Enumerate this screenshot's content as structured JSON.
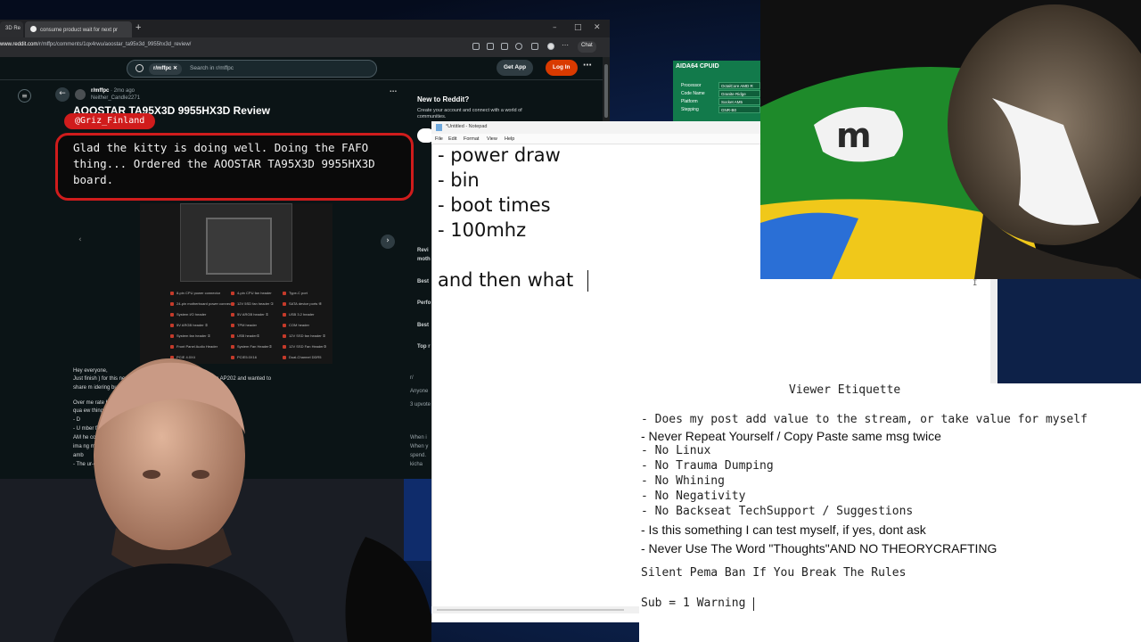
{
  "browser": {
    "tabs": [
      {
        "label": "3D Re"
      },
      {
        "label": "consume product wait for next pr"
      }
    ],
    "url_prefix": "www.reddit.com",
    "url_path": "/r/mffpc/comments/1qx4rwu/aoostar_ta95x3d_9955hx3d_review/",
    "chat_label": "Chat"
  },
  "reddit": {
    "search_chip": "r/mffpc",
    "search_placeholder": "Search in r/mffpc",
    "get_app": "Get App",
    "login": "Log In",
    "subreddit": "r/mffpc",
    "post_age": "· 2mo ago",
    "author": "Neither_Candle2271",
    "post_title": "AOOSTAR TA95X3D 9955HX3D Review",
    "image_legend": [
      "8-pin CPU power connector",
      "4-pin CPU fan header",
      "Type-C port",
      "24-pin motherboard power connector",
      "12V 5SD fan header ①",
      "SATA device ports ④",
      "System I/O header",
      "5V ARGB header ①",
      "USB 3.2 header",
      "5V ARGB header ②",
      "TPM header",
      "COM header",
      "System fan header ①",
      "USB header①",
      "12V SSD fan header ②",
      "Front Panel Audio Header",
      "System Fan Header②",
      "12V SSD Fan Header③",
      "PCIE 4.0X4",
      "PCIE5.0X16",
      "Dual-Channel DDR5"
    ],
    "body_lines": [
      "Hey everyone,",
      "Just finish                              ) for this newer Aoostar TA95X3D in my son's Asus AP202 and wanted to",
      "share m                                    idering buying this board.",
      "Over                                        me rate by about 20%. I am extremely impressed with the build",
      "qua                                          ew things:",
      "- D",
      "- U                                         mber fitted on the board sits a little higher than a standard",
      "AM                                          he cooler's fixing plate a little to fit the Deepcool 4S. I would",
      "ima                                         ng max temps around 65 °C with this cooler in 28 °C",
      "amb",
      "- The                                       ur-controlled by the BIOS only. So opted to use a Nollie USB"
    ],
    "rail": {
      "new_title": "New to Reddit?",
      "new_desc": "Create your account and connect with a world of communities.",
      "items": [
        "Revi",
        "moth",
        "Best",
        "Perfo",
        "Best",
        "Top r"
      ],
      "comment_lines": [
        "r/",
        "Anyone",
        "3 upvote",
        "When i",
        "When y",
        "spend.",
        "kicha"
      ]
    }
  },
  "chat_overlay": {
    "user": "@Griz_Finland",
    "message": "Glad the kitty is doing well. Doing the FAFO thing... Ordered the AOOSTAR TA95X3D 9955HX3D board."
  },
  "aida": {
    "title": "AIDA64 CPUID",
    "rows": [
      {
        "key": "Processor",
        "value": "OctalCore AMD R"
      },
      {
        "key": "Code Name",
        "value": "Granite Ridge"
      },
      {
        "key": "Platform",
        "value": "Socket AM5"
      },
      {
        "key": "Stepping",
        "value": "GNR-B0"
      }
    ]
  },
  "notepad": {
    "title": "*Untitled - Notepad",
    "menus": [
      "File",
      "Edit",
      "Format",
      "View",
      "Help"
    ],
    "lines": [
      "- power draw",
      "- bin",
      "- boot times",
      "- 100mhz",
      "and then what"
    ]
  },
  "etiquette": {
    "title": "Viewer Etiquette",
    "rules": [
      {
        "text": "- Does my post add value to the stream, or take value for myself",
        "style": "mono"
      },
      {
        "text": "-  Never Repeat Yourself / Copy Paste same msg twice",
        "style": "sans"
      },
      {
        "text": "- No Linux",
        "style": "mono"
      },
      {
        "text": "- No Trauma Dumping",
        "style": "mono"
      },
      {
        "text": "- No Whining",
        "style": "mono"
      },
      {
        "text": "- No Negativity",
        "style": "mono"
      },
      {
        "text": "- No Backseat TechSupport / Suggestions",
        "style": "mono"
      },
      {
        "text": "- Is this something I can test myself, if yes, dont ask",
        "style": "sans"
      },
      {
        "text": "- Never Use The Word \"Thoughts\"AND NO THEORYCRAFTING",
        "style": "sans"
      }
    ],
    "ban_line": "Silent Pema Ban If You Break The Rules",
    "sub_line": "Sub = 1 Warning"
  },
  "colors": {
    "chat_red": "#d01c1c",
    "reddit_orange": "#d93a00",
    "aida_green": "#127a4b",
    "reddit_bg": "#0b1416"
  }
}
